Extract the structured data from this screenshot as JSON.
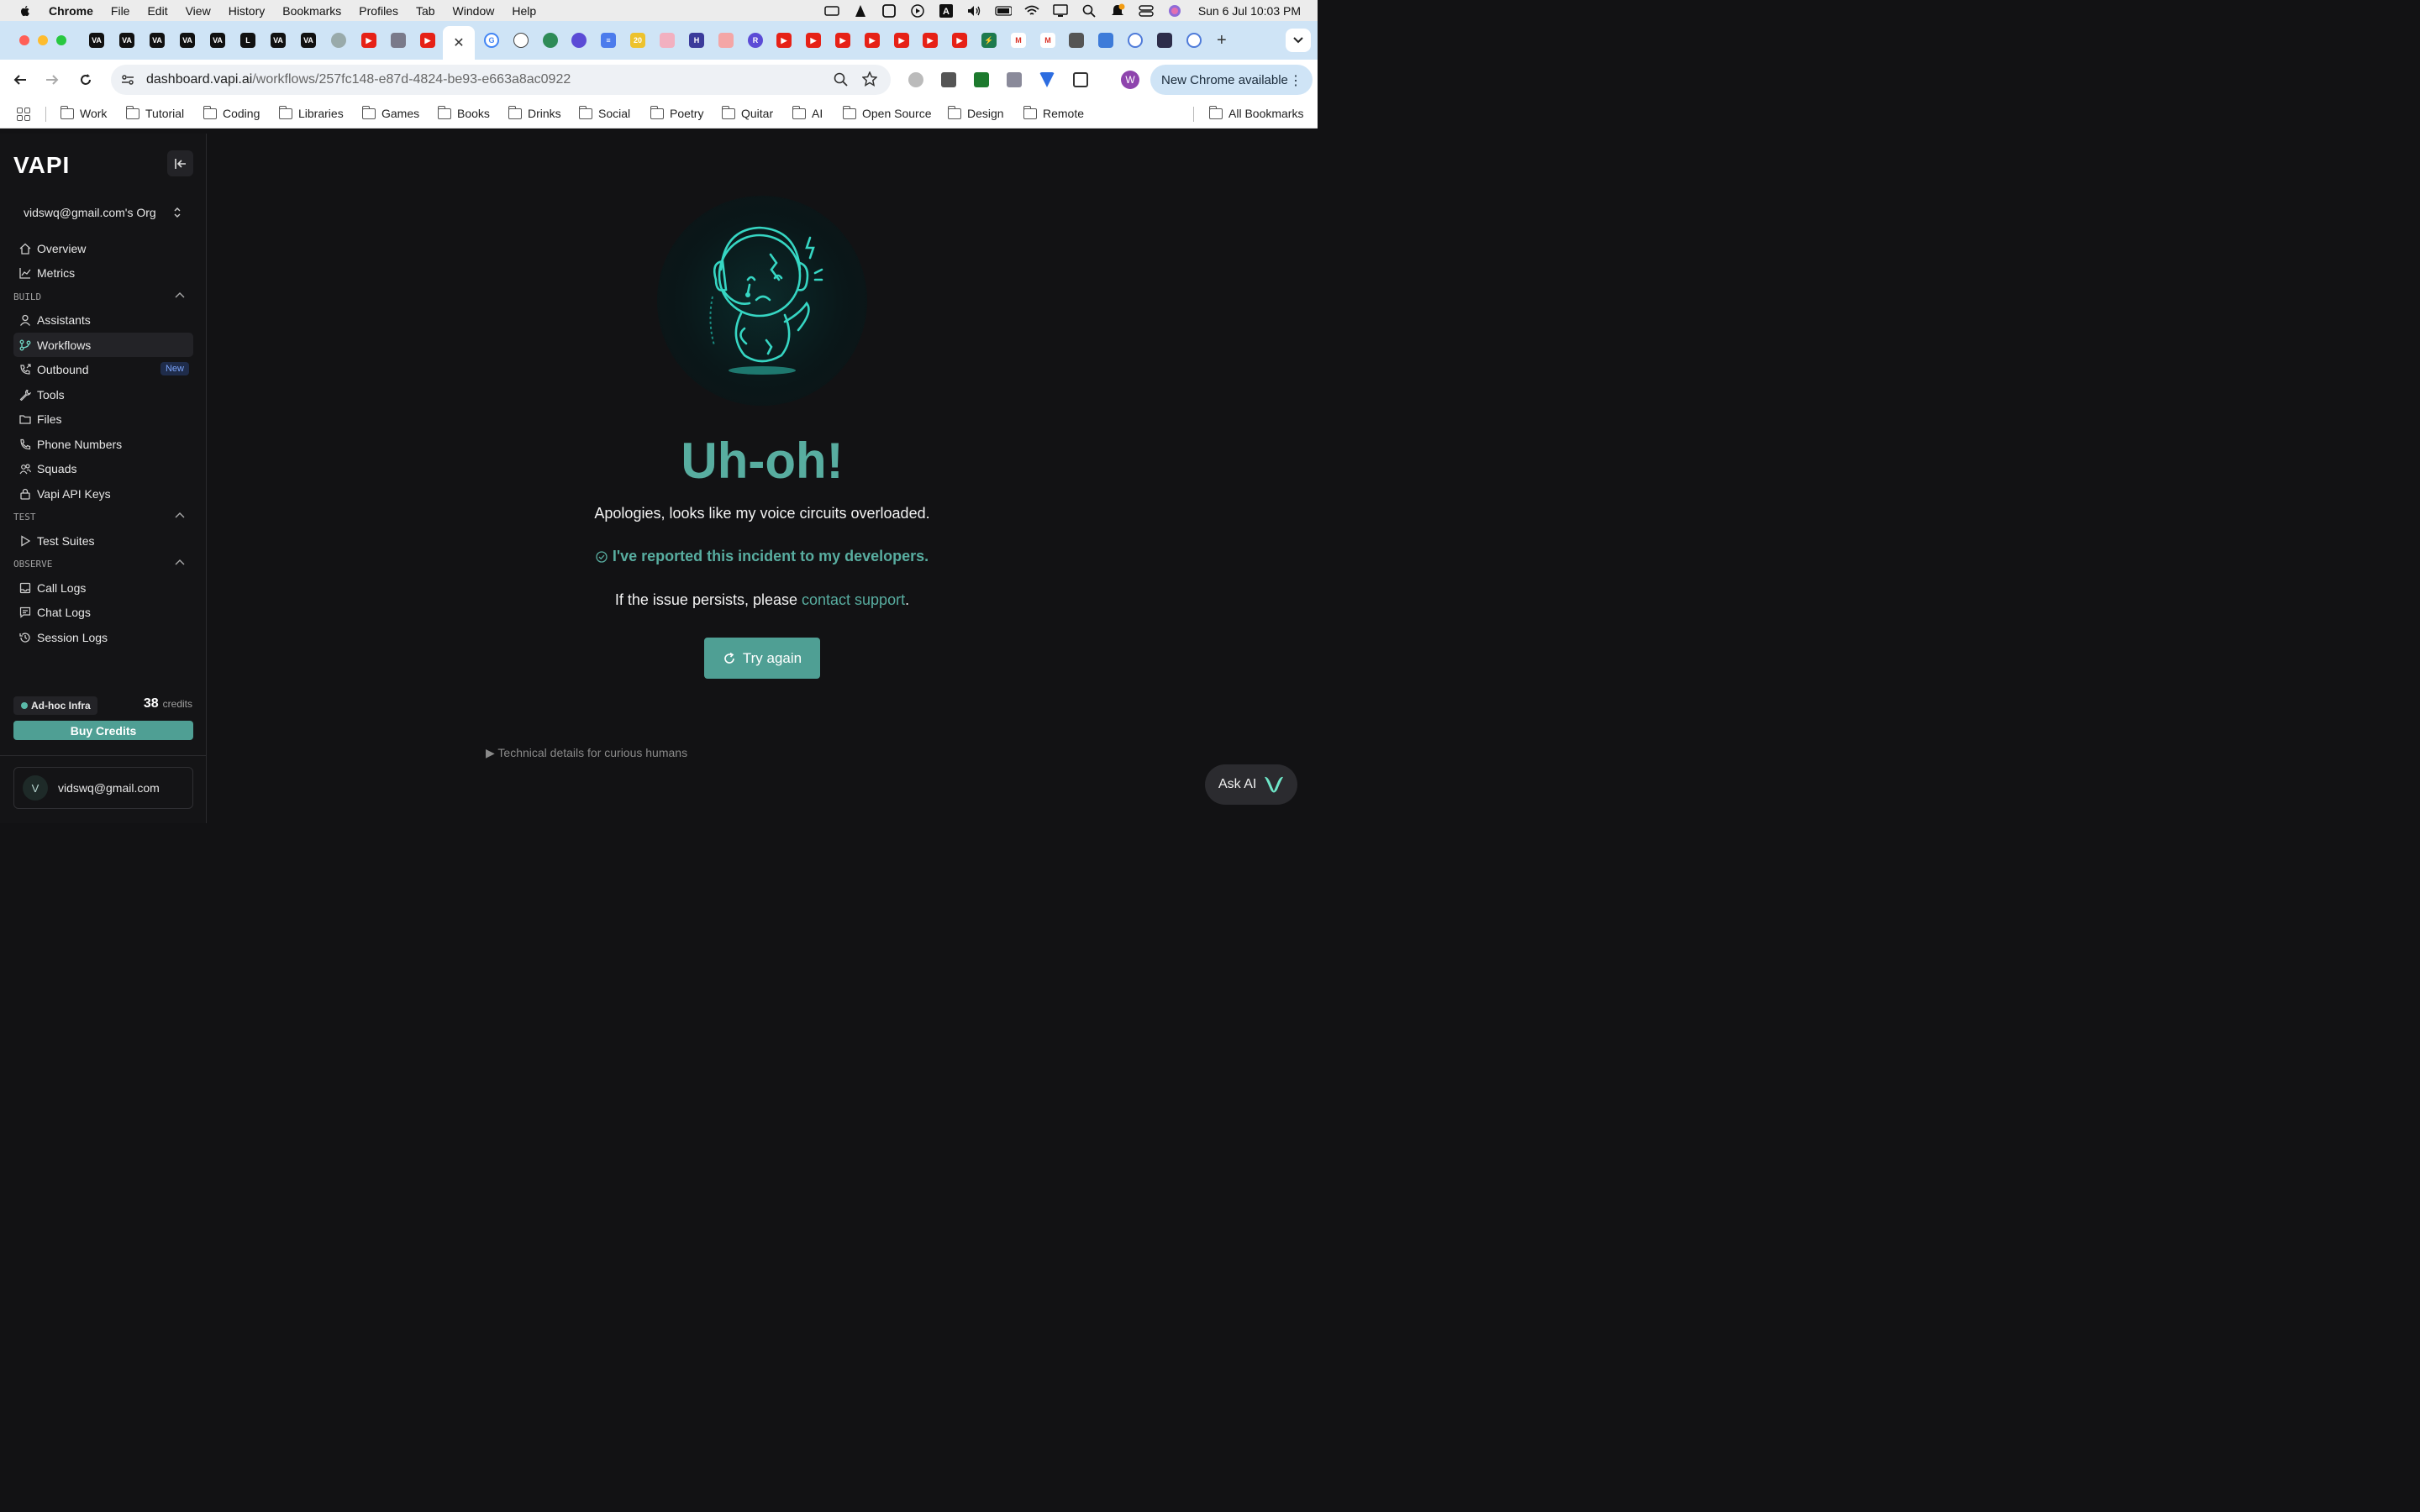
{
  "menubar": {
    "app_name": "Chrome",
    "items": [
      "File",
      "Edit",
      "View",
      "History",
      "Bookmarks",
      "Profiles",
      "Tab",
      "Window",
      "Help"
    ],
    "clock": "Sun 6 Jul  10:03 PM"
  },
  "browser": {
    "url_host": "dashboard.vapi.ai",
    "url_path": "/workflows/257fc148-e87d-4824-be93-e663a8ac0922",
    "update_label": "New Chrome available",
    "profile_initial": "W",
    "bookmarks": [
      "Work",
      "Tutorial",
      "Coding",
      "Libraries",
      "Games",
      "Books",
      "Drinks",
      "Social",
      "Poetry",
      "Quitar",
      "AI",
      "Open Source",
      "Design",
      "Remote"
    ],
    "all_bookmarks": "All Bookmarks"
  },
  "sidebar": {
    "logo": "VAPI",
    "org": "vidswq@gmail.com's Org",
    "top_items": [
      {
        "label": "Overview",
        "icon": "home-icon"
      },
      {
        "label": "Metrics",
        "icon": "chart-icon"
      }
    ],
    "sections": {
      "build": "BUILD",
      "test": "TEST",
      "observe": "OBSERVE"
    },
    "build_items": [
      {
        "label": "Assistants",
        "icon": "user-icon"
      },
      {
        "label": "Workflows",
        "icon": "branch-icon"
      },
      {
        "label": "Outbound",
        "icon": "phone-out-icon",
        "badge": "New"
      },
      {
        "label": "Tools",
        "icon": "wrench-icon"
      },
      {
        "label": "Files",
        "icon": "folder-icon"
      },
      {
        "label": "Phone Numbers",
        "icon": "phone-icon"
      },
      {
        "label": "Squads",
        "icon": "users-icon"
      },
      {
        "label": "Vapi API Keys",
        "icon": "lock-icon"
      }
    ],
    "test_items": [
      {
        "label": "Test Suites",
        "icon": "play-icon"
      }
    ],
    "observe_items": [
      {
        "label": "Call Logs",
        "icon": "inbox-icon"
      },
      {
        "label": "Chat Logs",
        "icon": "message-icon"
      },
      {
        "label": "Session Logs",
        "icon": "history-icon"
      }
    ],
    "infra": "Ad-hoc Infra",
    "credits_value": "38",
    "credits_unit": "credits",
    "buy_credits": "Buy Credits",
    "user_initial": "V",
    "user_email": "vidswq@gmail.com"
  },
  "error": {
    "headline": "Uh-oh!",
    "apology": "Apologies, looks like my voice circuits overloaded.",
    "reported": "I've reported this incident to my developers.",
    "persist_prefix": "If the issue persists, please ",
    "persist_link": "contact support",
    "persist_suffix": ".",
    "try_again": "Try again",
    "details": "▶ Technical details for curious humans"
  },
  "ask_ai": "Ask AI",
  "colors": {
    "accent": "#58ada0",
    "button": "#4f9f94",
    "background": "#121214",
    "sidebar": "#141416"
  }
}
